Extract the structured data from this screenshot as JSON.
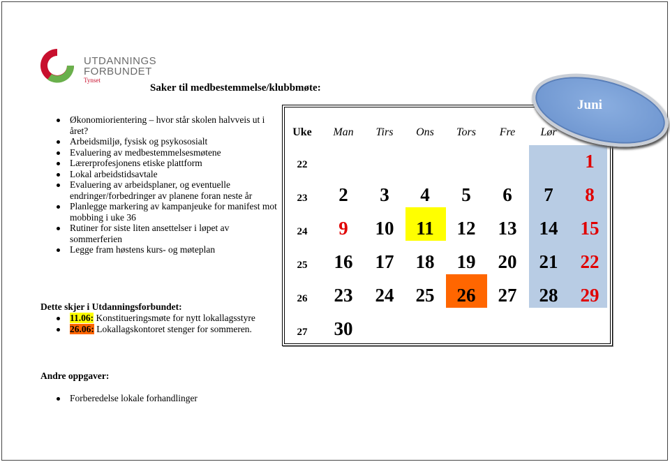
{
  "logo": {
    "line1": "UTDANNINGS",
    "line2": "FORBUNDET",
    "sub": "Tynset"
  },
  "title": "Saker til medbestemmelse/klubbmøte:",
  "items": [
    "Økonomiorientering – hvor står skolen halvveis ut i året?",
    "Arbeidsmiljø, fysisk og psykososialt",
    "Evaluering av medbestemmelsesmøtene",
    "Lærerprofesjonens etiske plattform",
    "Lokal arbeidstidsavtale",
    "Evaluering av arbeidsplaner, og eventuelle endringer/forbedringer av planene foran neste år",
    "Planlegge markering av kampanjeuke for manifest mot mobbing i uke 36",
    "Rutiner for siste liten ansettelser i løpet av sommerferien",
    "Legge fram høstens kurs- og møteplan"
  ],
  "events": {
    "heading": "Dette skjer i Utdanningsforbundet:",
    "items": [
      {
        "date": "11.06:",
        "text": " Konstitueringsmøte for nytt lokallagsstyre",
        "color": "#ffff00"
      },
      {
        "date": "26.06:",
        "text": " Lokallagskontoret stenger for sommeren.",
        "color": "#ff6600"
      }
    ]
  },
  "other": {
    "heading": "Andre oppgaver:",
    "items": [
      "Forberedelse lokale forhandlinger"
    ]
  },
  "calendar": {
    "month": "Juni",
    "headers": [
      "Uke",
      "Man",
      "Tirs",
      "Ons",
      "Tors",
      "Fre",
      "Lør"
    ],
    "weeks": [
      {
        "week": "22",
        "days": [
          "",
          "",
          "",
          "",
          "",
          "",
          "1"
        ]
      },
      {
        "week": "23",
        "days": [
          "2",
          "3",
          "4",
          "5",
          "6",
          "7",
          "8"
        ]
      },
      {
        "week": "24",
        "days": [
          "9",
          "10",
          "11",
          "12",
          "13",
          "14",
          "15"
        ]
      },
      {
        "week": "25",
        "days": [
          "16",
          "17",
          "18",
          "19",
          "20",
          "21",
          "22"
        ]
      },
      {
        "week": "26",
        "days": [
          "23",
          "24",
          "25",
          "26",
          "27",
          "28",
          "29"
        ]
      },
      {
        "week": "27",
        "days": [
          "30",
          "",
          "",
          "",
          "",
          "",
          ""
        ]
      }
    ],
    "highlight_yellow": "11",
    "highlight_orange": "26",
    "weekend_color": "#b8cce4",
    "sunday_color": "#e00000",
    "red_days": [
      "9"
    ]
  }
}
